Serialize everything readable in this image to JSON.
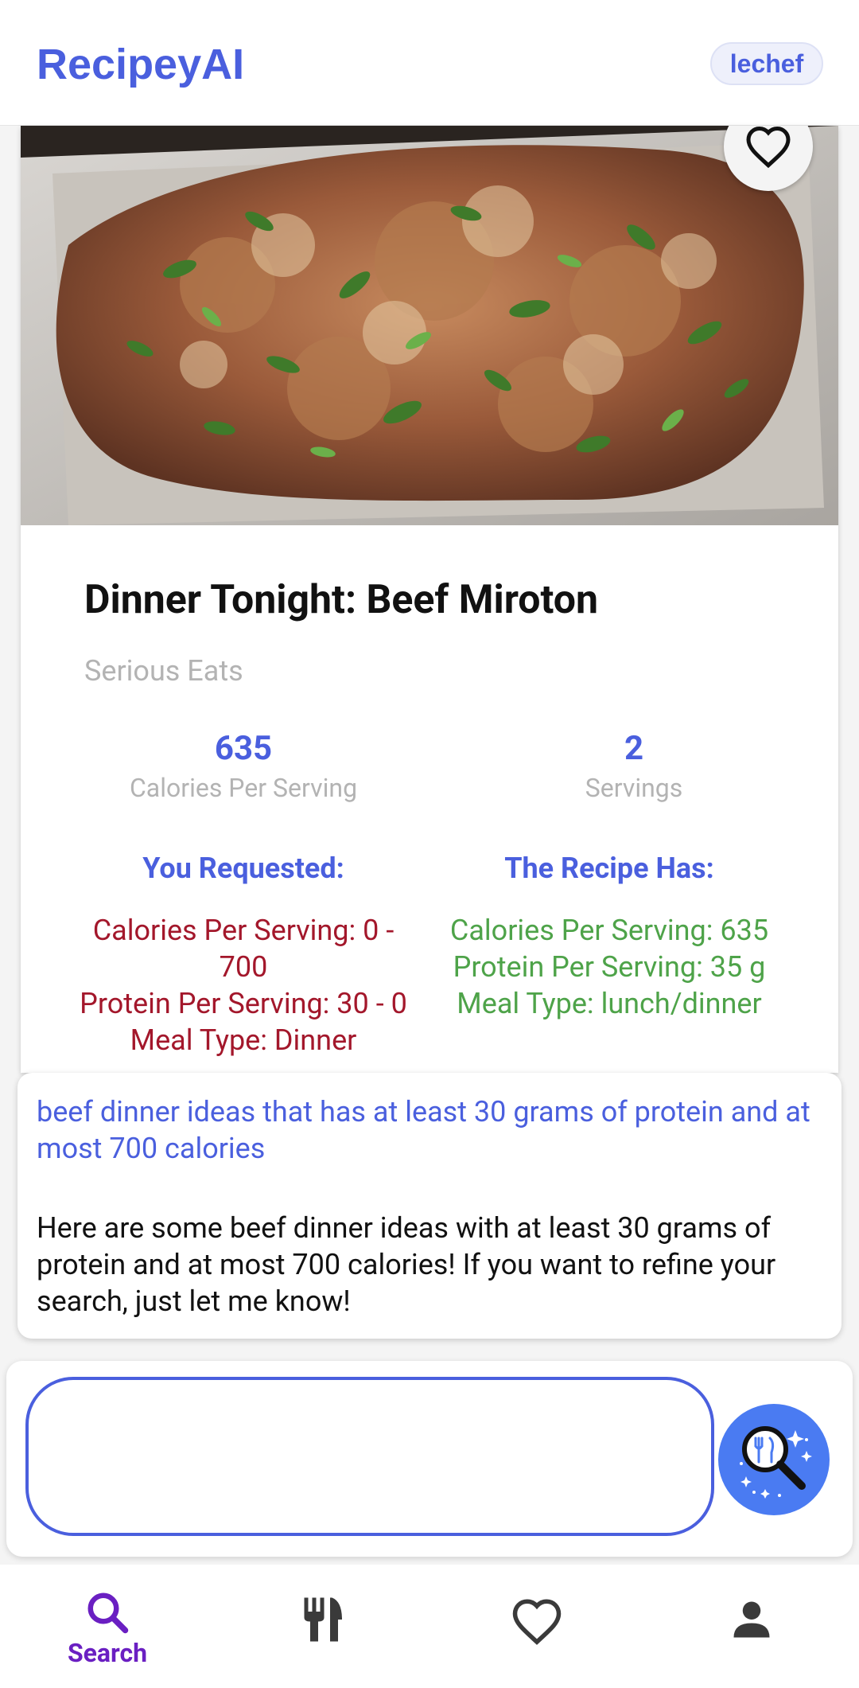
{
  "header": {
    "app_title": "RecipeyAI",
    "user_label": "lechef"
  },
  "recipe": {
    "title": "Dinner Tonight: Beef Miroton",
    "source": "Serious Eats",
    "stats": {
      "calories_value": "635",
      "calories_label": "Calories Per Serving",
      "servings_value": "2",
      "servings_label": "Servings"
    },
    "requested": {
      "heading": "You Requested:",
      "lines": [
        "Calories Per Serving: 0 -",
        "700",
        "Protein Per Serving: 30 - 0",
        "Meal Type: Dinner"
      ]
    },
    "has": {
      "heading": "The Recipe Has:",
      "lines": [
        "Calories Per Serving: 635",
        "Protein Per Serving: 35 g",
        "Meal Type: lunch/dinner"
      ]
    }
  },
  "chat": {
    "query": "beef dinner ideas that has at least 30 grams of protein and at most 700 calories",
    "reply": "Here are some beef dinner ideas with at least 30 grams of protein and at most 700 calories! If you want to refine your search, just let me know!"
  },
  "search": {
    "value": "",
    "placeholder": ""
  },
  "nav": {
    "items": [
      {
        "label": "Search",
        "icon": "search-icon",
        "active": true
      },
      {
        "label": "",
        "icon": "cutlery-icon",
        "active": false
      },
      {
        "label": "",
        "icon": "heart-icon",
        "active": false
      },
      {
        "label": "",
        "icon": "person-icon",
        "active": false
      }
    ]
  },
  "colors": {
    "accent": "#4a5fde",
    "requested_text": "#a3172b",
    "has_text": "#4ea349",
    "nav_active": "#6a1fc2",
    "search_button": "#4a7bf2"
  }
}
